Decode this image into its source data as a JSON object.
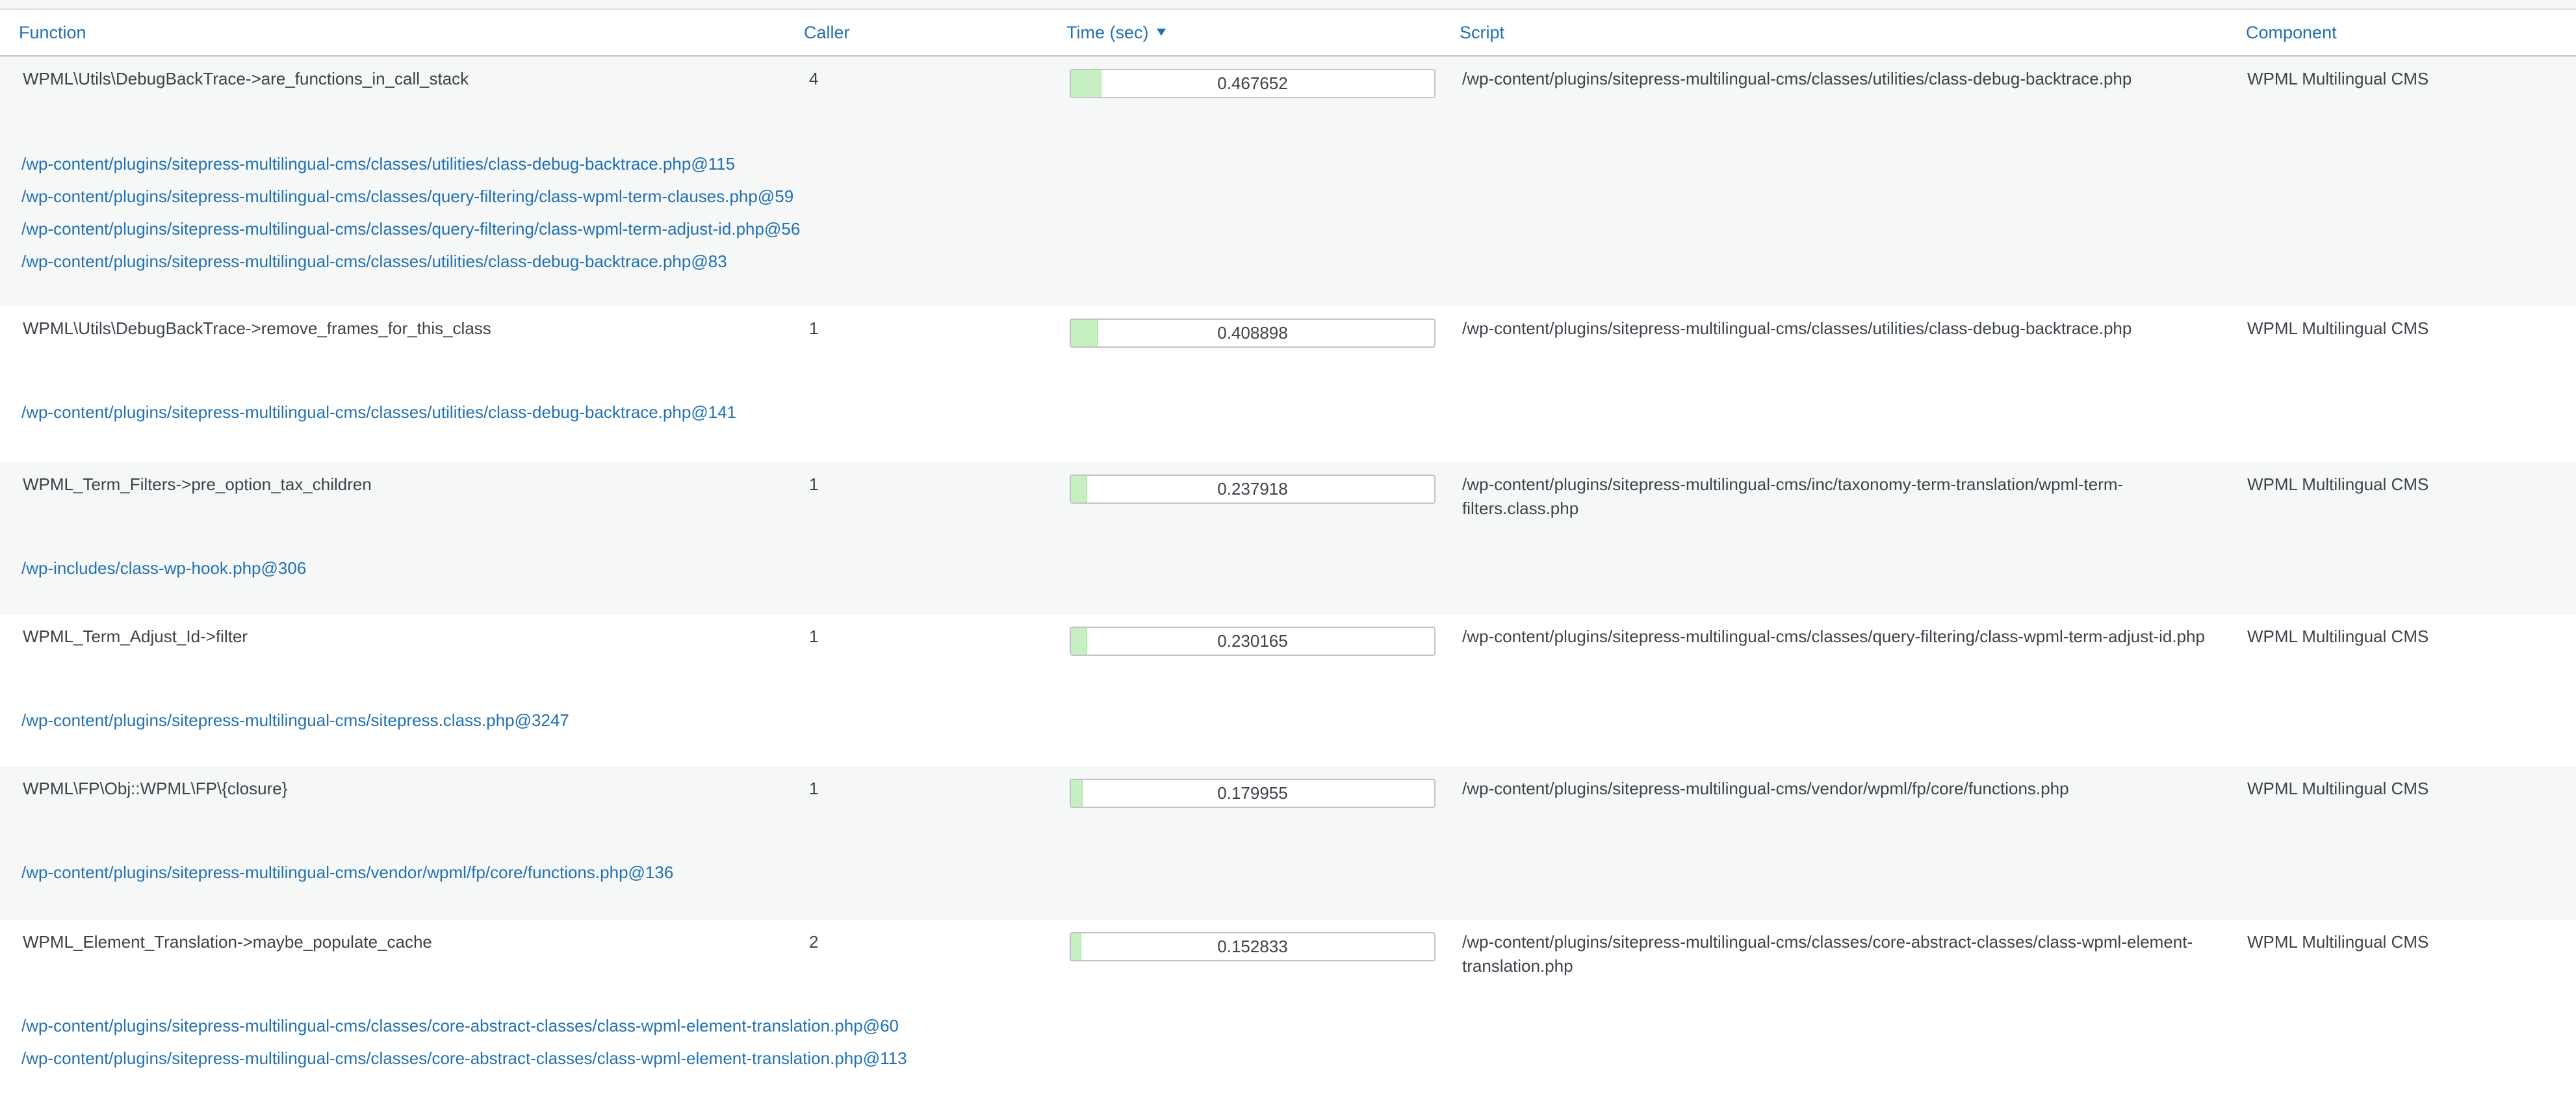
{
  "headers": {
    "function": "Function",
    "caller": "Caller",
    "time": "Time (sec)",
    "script": "Script",
    "component": "Component"
  },
  "colors": {
    "link": "#2271b1",
    "bar_fill": "#c6f0c2",
    "row_alt": "#f6f7f7"
  },
  "rows": [
    {
      "function": "WPML\\Utils\\DebugBackTrace->are_functions_in_call_stack",
      "caller": "4",
      "time": "0.467652",
      "time_fraction": 0.083,
      "script": "/wp-content/plugins/sitepress-multilingual-cms/classes/utilities/class-debug-backtrace.php",
      "component": "WPML Multilingual CMS",
      "stack": [
        "/wp-content/plugins/sitepress-multilingual-cms/classes/utilities/class-debug-backtrace.php@115",
        "/wp-content/plugins/sitepress-multilingual-cms/classes/query-filtering/class-wpml-term-clauses.php@59",
        "/wp-content/plugins/sitepress-multilingual-cms/classes/query-filtering/class-wpml-term-adjust-id.php@56",
        "/wp-content/plugins/sitepress-multilingual-cms/classes/utilities/class-debug-backtrace.php@83"
      ]
    },
    {
      "function": "WPML\\Utils\\DebugBackTrace->remove_frames_for_this_class",
      "caller": "1",
      "time": "0.408898",
      "time_fraction": 0.073,
      "script": "/wp-content/plugins/sitepress-multilingual-cms/classes/utilities/class-debug-backtrace.php",
      "component": "WPML Multilingual CMS",
      "stack": [
        "/wp-content/plugins/sitepress-multilingual-cms/classes/utilities/class-debug-backtrace.php@141"
      ]
    },
    {
      "function": "WPML_Term_Filters->pre_option_tax_children",
      "caller": "1",
      "time": "0.237918",
      "time_fraction": 0.043,
      "script": "/wp-content/plugins/sitepress-multilingual-cms/inc/taxonomy-term-translation/wpml-term-filters.class.php",
      "component": "WPML Multilingual CMS",
      "stack": [
        "/wp-includes/class-wp-hook.php@306"
      ]
    },
    {
      "function": "WPML_Term_Adjust_Id->filter",
      "caller": "1",
      "time": "0.230165",
      "time_fraction": 0.043,
      "script": "/wp-content/plugins/sitepress-multilingual-cms/classes/query-filtering/class-wpml-term-adjust-id.php",
      "component": "WPML Multilingual CMS",
      "stack": [
        "/wp-content/plugins/sitepress-multilingual-cms/sitepress.class.php@3247"
      ]
    },
    {
      "function": "WPML\\FP\\Obj::WPML\\FP\\{closure}",
      "caller": "1",
      "time": "0.179955",
      "time_fraction": 0.03,
      "script": "/wp-content/plugins/sitepress-multilingual-cms/vendor/wpml/fp/core/functions.php",
      "component": "WPML Multilingual CMS",
      "stack": [
        "/wp-content/plugins/sitepress-multilingual-cms/vendor/wpml/fp/core/functions.php@136"
      ]
    },
    {
      "function": "WPML_Element_Translation->maybe_populate_cache",
      "caller": "2",
      "time": "0.152833",
      "time_fraction": 0.027,
      "script": "/wp-content/plugins/sitepress-multilingual-cms/classes/core-abstract-classes/class-wpml-element-translation.php",
      "component": "WPML Multilingual CMS",
      "stack": [
        "/wp-content/plugins/sitepress-multilingual-cms/classes/core-abstract-classes/class-wpml-element-translation.php@60",
        "/wp-content/plugins/sitepress-multilingual-cms/classes/core-abstract-classes/class-wpml-element-translation.php@113"
      ]
    }
  ]
}
